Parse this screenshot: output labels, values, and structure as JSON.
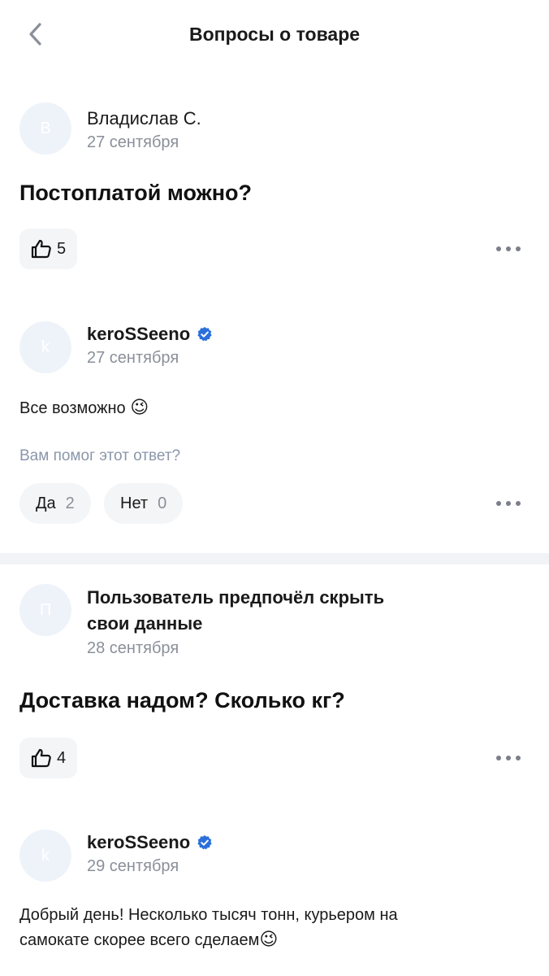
{
  "header": {
    "title": "Вопросы о товаре",
    "back_icon": "chevron-left-icon"
  },
  "questions": [
    {
      "author": {
        "avatar": "В",
        "name": "Владислав С.",
        "date": "27 сентября"
      },
      "text": "Постоплатой можно?",
      "likes": "5",
      "answer": {
        "author": {
          "avatar": "k",
          "name": "keroSSeeno",
          "date": "27 сентября",
          "verified": true
        },
        "text": "Все возможно",
        "emoji": "😉",
        "helpful_prompt": "Вам помог этот ответ?",
        "yes_label": "Да",
        "yes_count": "2",
        "no_label": "Нет",
        "no_count": "0"
      }
    },
    {
      "author": {
        "avatar": "П",
        "name_line1": "Пользователь предпочёл скрыть",
        "name_line2": "свои данные",
        "date": "28 сентября"
      },
      "text": "Доставка надом? Сколько кг?",
      "likes": "4",
      "answer": {
        "author": {
          "avatar": "k",
          "name": "keroSSeeno",
          "date": "29 сентября",
          "verified": true
        },
        "text_line1": "Добрый день! Несколько тысяч тонн, курьером на",
        "text_line2": "самокате скорее всего сделаем",
        "emoji": "😉"
      }
    }
  ],
  "colors": {
    "accent": "#2b6fdb",
    "muted": "#8a8f99",
    "pill_bg": "#f4f5f7",
    "avatar_bg": "#eef3fa"
  }
}
